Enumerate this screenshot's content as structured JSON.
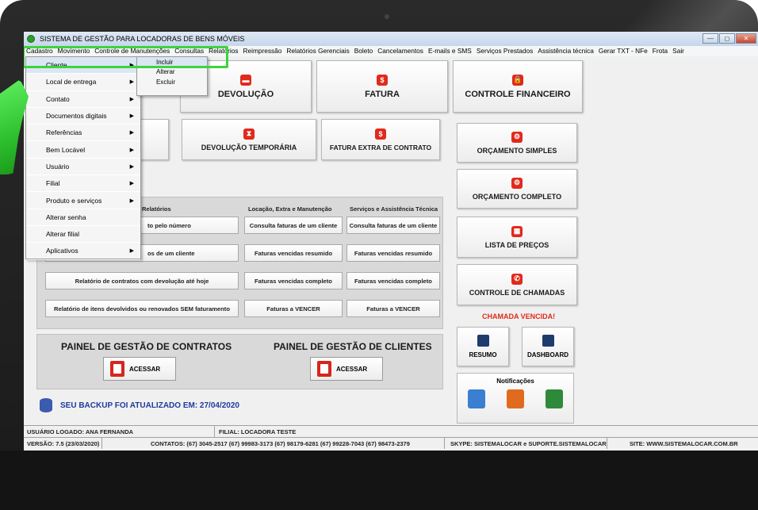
{
  "window": {
    "title": "SISTEMA DE GESTÃO PARA LOCADORAS DE BENS MÓVEIS",
    "min": "—",
    "max": "◻",
    "close": "✕"
  },
  "menubar": [
    "Cadastro",
    "Movimento",
    "Controle de Manutenções",
    "Consultas",
    "Relatórios",
    "Reimpressão",
    "Relatórios Gerenciais",
    "Boleto",
    "Cancelamentos",
    "E-mails e SMS",
    "Serviços Prestados",
    "Assistência técnica",
    "Gerar TXT - NFe",
    "Frota",
    "Sair"
  ],
  "dropdown": [
    {
      "label": "Cliente",
      "arrow": "▶"
    },
    {
      "label": "Local de entrega",
      "arrow": "▶"
    },
    {
      "label": "Contato",
      "arrow": "▶"
    },
    {
      "label": "Documentos digitais",
      "arrow": "▶"
    },
    {
      "label": "Referências",
      "arrow": "▶"
    },
    {
      "label": "Bem Locável",
      "arrow": "▶"
    },
    {
      "label": "Usuário",
      "arrow": "▶"
    },
    {
      "label": "Filial",
      "arrow": "▶"
    },
    {
      "label": "Produto e serviços",
      "arrow": "▶"
    },
    {
      "label": "Alterar senha",
      "arrow": ""
    },
    {
      "label": "Alterar filial",
      "arrow": ""
    },
    {
      "label": "Aplicativos",
      "arrow": "▶"
    }
  ],
  "submenu": [
    "Incluir",
    "Alterar",
    "Excluir"
  ],
  "main_buttons": {
    "devolucao": {
      "label": "DEVOLUÇÃO",
      "icon": "▬"
    },
    "fatura": {
      "label": "FATURA",
      "icon": "$"
    },
    "controle_financeiro": {
      "label": "CONTROLE FINANCEIRO",
      "icon": "🔒"
    },
    "devolucao_temporaria": {
      "label": "DEVOLUÇÃO TEMPORÁRIA",
      "icon": "⧗"
    },
    "fatura_extra": {
      "label": "FATURA EXTRA DE CONTRATO",
      "icon": "$"
    },
    "orcamento_simples": {
      "label": "ORÇAMENTO SIMPLES",
      "icon": "⚙"
    },
    "orcamento_completo": {
      "label": "ORÇAMENTO COMPLETO",
      "icon": "⚙"
    },
    "lista_precos": {
      "label": "LISTA DE PREÇOS",
      "icon": "▦"
    },
    "controle_chamadas": {
      "label": "CONTROLE DE CHAMADAS",
      "icon": "✆"
    }
  },
  "reports": {
    "headers": [
      "Relatórios",
      "Locação, Extra e Manutenção",
      "Serviços e Assistência Técnica"
    ],
    "col1": [
      "to pelo número",
      "os de um cliente",
      "Relatório de contratos com devolução até hoje",
      "Relatório de itens devolvidos ou renovados SEM faturamento"
    ],
    "col2": [
      "Consulta faturas de um cliente",
      "Faturas vencidas resumido",
      "Faturas vencidas completo",
      "Faturas a VENCER"
    ],
    "col3": [
      "Consulta faturas de um cliente",
      "Faturas vencidas resumido",
      "Faturas vencidas completo",
      "Faturas a VENCER"
    ]
  },
  "panels": {
    "contratos_title": "PAINEL DE GESTÃO DE CONTRATOS",
    "clientes_title": "PAINEL DE GESTÃO DE CLIENTES",
    "acessar": "ACESSAR"
  },
  "backup": "SEU BACKUP FOI ATUALIZADO EM: 27/04/2020",
  "chamada_vencida": "CHAMADA VENCIDA!",
  "resumo": "RESUMO",
  "dashboard": "DASHBOARD",
  "notificacoes": "Notificações",
  "status": {
    "usuario": "USUÁRIO LOGADO: ANA FERNANDA",
    "filial": "FILIAL: LOCADORA TESTE",
    "versao": "VERSÃO: 7.5 (23/03/2020)",
    "contatos": "CONTATOS: (67) 3045-2517  (67) 99983-3173  (67) 98179-6281  (67) 99228-7043  (67) 98473-2379",
    "skype": "SKYPE: SISTEMALOCAR e SUPORTE.SISTEMALOCAR",
    "site": "SITE: WWW.SISTEMALOCAR.COM.BR"
  },
  "colors": {
    "accent_red": "#e02a1c",
    "highlight_green": "#3cd43c",
    "backup_blue": "#1f3b9c"
  }
}
